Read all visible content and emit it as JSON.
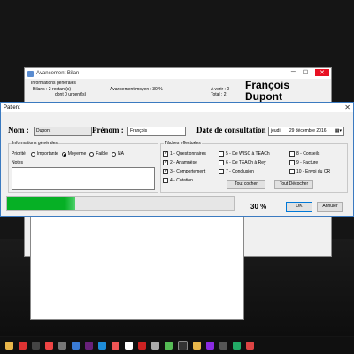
{
  "background_window": {
    "title": "Avancement Bilan",
    "section_label": "Informations générales",
    "bilans_line": "Bilans :  2 restant(s)",
    "dont_line": "dont 0 urgent(s)",
    "avancement": "Avancement moyen : 30 %",
    "a_verir": "A verir : 0",
    "total": "Total : 2",
    "name_first": "François",
    "name_last": "Dupont"
  },
  "dialog": {
    "title": "Patient",
    "close_glyph": "✕",
    "nom_label": "Nom :",
    "nom_value": "Dupont",
    "prenom_label": "Prénom :",
    "prenom_value": "François",
    "date_label": "Date de consultation :",
    "date_day": "jeudi",
    "date_value": "29 décembre 2016",
    "info_group": "Informations générales",
    "priorite_label": "Priorité",
    "priorities": [
      "Importante",
      "Moyenne",
      "Faible",
      "NA"
    ],
    "selected_priority": "Moyenne",
    "notes_label": "Notes",
    "notes_value": "",
    "taches_group": "Tâches effectuées",
    "tasks": [
      {
        "label": "1 - Questionnaires",
        "checked": true
      },
      {
        "label": "2 - Anamnèse",
        "checked": true
      },
      {
        "label": "3 - Comportement",
        "checked": true
      },
      {
        "label": "4 - Cotation",
        "checked": false
      },
      {
        "label": "5 - De WISC à TEACh",
        "checked": false
      },
      {
        "label": "6 - De TEACh à Rey",
        "checked": false
      },
      {
        "label": "7 - Conclusion",
        "checked": false
      },
      {
        "label": "8 - Conseils",
        "checked": false
      },
      {
        "label": "9 - Facture",
        "checked": false
      },
      {
        "label": "10 - Envoi du CR",
        "checked": false
      }
    ],
    "tout_cocher": "Tout cocher",
    "tout_decocher": "Tout Décocher",
    "progress_fraction": 0.3,
    "progress_text": "30 %",
    "ok": "OK",
    "annuler": "Annuler"
  },
  "colors": {
    "progress": "#06b025",
    "accent": "#0078d7"
  }
}
